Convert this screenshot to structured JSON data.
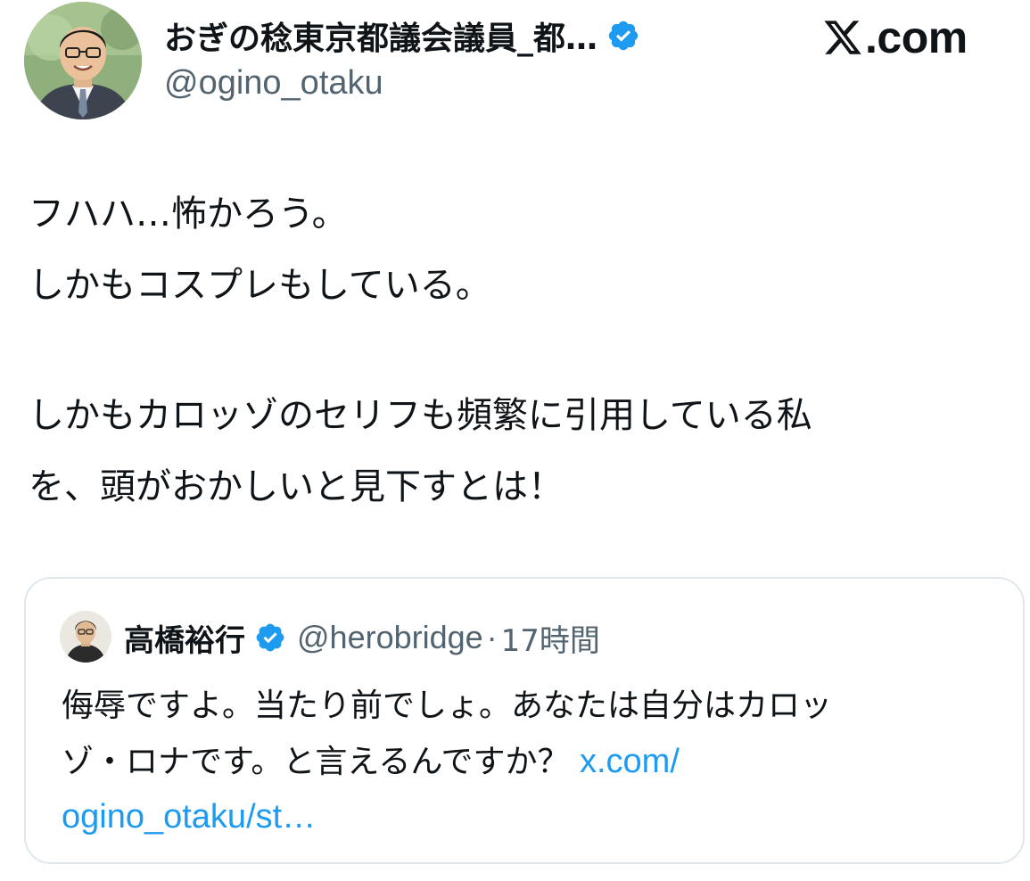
{
  "author": {
    "display_name": "おぎの稔東京都議会議員_都…",
    "handle": "@ogino_otaku",
    "verified_badge_color": "#1d9bf0",
    "avatar_icon": "profile-photo"
  },
  "brand": {
    "logo_text": ".com",
    "logo_icon": "x-logo-icon"
  },
  "tweet": {
    "lines": [
      "フハハ…怖かろう。",
      "しかもコスプレもしている。",
      "",
      "しかもカロッゾのセリフも頻繁に引用している私",
      "を、頭がおかしいと見下すとは！"
    ]
  },
  "quote": {
    "display_name": "高橋裕行",
    "handle": "@herobridge",
    "separator": "·",
    "time": "17時間",
    "line1": "侮辱ですよ。当たり前でしょ。あなたは自分はカロッ",
    "line2_text": "ゾ・ロナです。と言えるんですか？ ",
    "line2_link": "x.com/",
    "line3_link": "ogino_otaku/st…",
    "link_color": "#1d9bf0"
  },
  "colors": {
    "text_primary": "#0f1419",
    "text_secondary": "#536471",
    "border": "#e1e8ed"
  }
}
